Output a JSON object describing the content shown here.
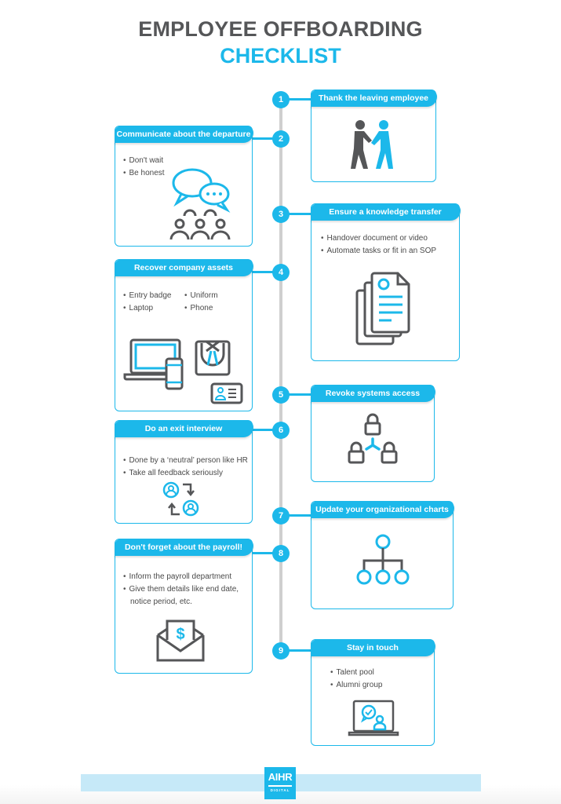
{
  "title": {
    "line1": "EMPLOYEE OFFBOARDING",
    "line2": "CHECKLIST"
  },
  "colors": {
    "accent": "#1cb8ea",
    "dark": "#555658",
    "timeline": "#cfcfcf",
    "footer_band": "#c6e9f8"
  },
  "steps": [
    {
      "number": "1",
      "title": "Thank the leaving employee",
      "bullets": [],
      "icon": "handshake-icon"
    },
    {
      "number": "2",
      "title": "Communicate about the departure",
      "bullets": [
        "Don't wait",
        "Be honest"
      ],
      "icon": "group-conversation-icon"
    },
    {
      "number": "3",
      "title": "Ensure a knowledge transfer",
      "bullets": [
        "Handover document or video",
        "Automate tasks or fit in an SOP"
      ],
      "icon": "documents-icon"
    },
    {
      "number": "4",
      "title": "Recover company assets",
      "bullets": [
        "Entry badge",
        "Uniform",
        "Laptop",
        "Phone"
      ],
      "icon": "assets-icon"
    },
    {
      "number": "5",
      "title": "Revoke systems access",
      "bullets": [],
      "icon": "locks-network-icon"
    },
    {
      "number": "6",
      "title": "Do an exit interview",
      "bullets": [
        "Done by a ‘neutral’ person like HR",
        "Take all feedback seriously"
      ],
      "icon": "interview-exchange-icon"
    },
    {
      "number": "7",
      "title": "Update your organizational charts",
      "bullets": [],
      "icon": "org-chart-icon"
    },
    {
      "number": "8",
      "title": "Don't forget about the payroll!",
      "bullets": [
        "Inform the payroll department",
        "Give them details like end date,",
        "notice period, etc."
      ],
      "icon": "payroll-envelope-icon"
    },
    {
      "number": "9",
      "title": "Stay in touch",
      "bullets": [
        "Talent pool",
        "Alumni group"
      ],
      "icon": "laptop-chat-icon"
    }
  ],
  "footer": {
    "logo_main": "AIHR",
    "logo_sub": "DIGITAL"
  }
}
